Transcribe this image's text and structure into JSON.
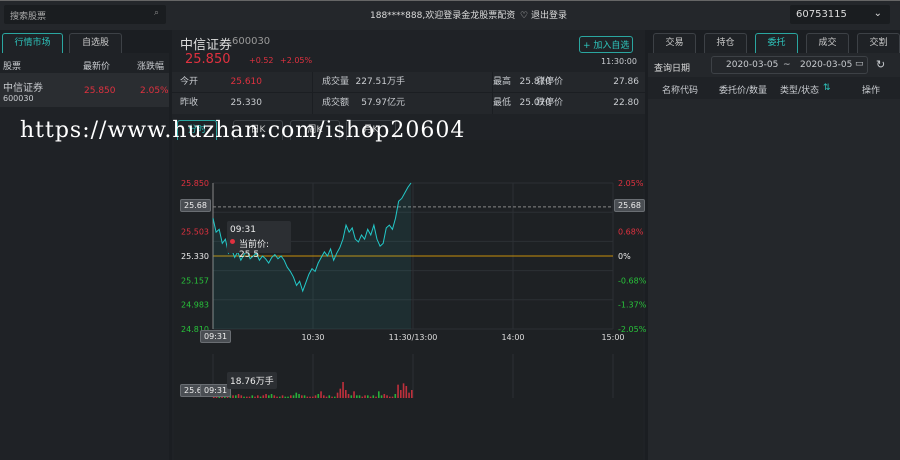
{
  "topbar": {
    "search_placeholder": "搜索股票",
    "welcome": "188****888,欢迎登录金龙股票配资",
    "logout": "退出登录",
    "account": "60753115"
  },
  "left": {
    "tabs": [
      "行情市场",
      "自选股"
    ],
    "headers": [
      "股票",
      "最新价",
      "涨跌幅"
    ],
    "items": [
      {
        "name": "中信证券",
        "code": "600030",
        "price": "25.850",
        "change": "2.05%"
      }
    ]
  },
  "stock": {
    "name": "中信证券",
    "code": "600030",
    "price": "25.850",
    "change": "+0.52",
    "change_pct": "+2.05%",
    "add_watch": "+ 加入自选",
    "time": "11:30:00",
    "stats": [
      [
        "今开",
        "25.610",
        "成交量",
        "227.51万手",
        "最高",
        "25.870",
        "涨停价",
        "27.86"
      ],
      [
        "昨收",
        "25.330",
        "成交额",
        "57.97亿元",
        "最低",
        "25.070",
        "跌停价",
        "22.80"
      ]
    ]
  },
  "chart_tabs": [
    "分时",
    "日K",
    "周K",
    "月K"
  ],
  "chart_data": {
    "type": "line",
    "x_ticks": [
      "09:31",
      "10:30",
      "11:30/13:00",
      "14:00",
      "15:00"
    ],
    "y_left": [
      "25.850",
      "25.503",
      "25.330",
      "25.157",
      "24.983",
      "24.810"
    ],
    "y_right": [
      "2.05%",
      "0.68%",
      "0%",
      "-0.68%",
      "-1.37%",
      "-2.05%"
    ],
    "ylim": [
      24.81,
      25.85
    ],
    "prev_close": 25.33,
    "crosshair_price": "25.68",
    "crosshair_time": "09:31",
    "tooltip": {
      "time": "09:31",
      "label": "当前价: 25.5"
    },
    "volume_tooltip": "18.76万手",
    "volume_axis_tag": "25.6",
    "prices": [
      25.6,
      25.5,
      25.52,
      25.42,
      25.45,
      25.35,
      25.38,
      25.32,
      25.36,
      25.3,
      25.34,
      25.37,
      25.31,
      25.33,
      25.35,
      25.3,
      25.33,
      25.31,
      25.28,
      25.32,
      25.34,
      25.31,
      25.33,
      25.3,
      25.25,
      25.22,
      25.18,
      25.12,
      25.15,
      25.08,
      25.14,
      25.2,
      25.24,
      25.22,
      25.28,
      25.32,
      25.36,
      25.33,
      25.38,
      25.3,
      25.35,
      25.39,
      25.45,
      25.55,
      25.5,
      25.53,
      25.45,
      25.43,
      25.48,
      25.45,
      25.52,
      25.48,
      25.55,
      25.45,
      25.4,
      25.42,
      25.53,
      25.55,
      25.52,
      25.6,
      25.72,
      25.74,
      25.78,
      25.82,
      25.85
    ],
    "volumes": [
      9,
      3,
      2,
      4,
      3,
      2,
      3,
      2,
      2,
      3,
      2,
      1,
      1,
      1,
      2,
      1,
      2,
      1,
      2,
      3,
      2,
      3,
      2,
      1,
      1,
      2,
      1,
      1,
      2,
      2,
      4,
      3,
      2,
      2,
      1,
      1,
      1,
      2,
      3,
      5,
      2,
      1,
      2,
      1,
      1,
      4,
      7,
      12,
      6,
      3,
      2,
      5,
      2,
      2,
      1,
      2,
      2,
      1,
      2,
      1,
      5,
      2,
      3,
      2,
      1,
      1,
      3,
      10,
      6,
      11,
      9,
      4,
      6
    ]
  },
  "right": {
    "tabs": [
      "交易",
      "持仓",
      "委托",
      "成交",
      "交割"
    ],
    "date_label": "查询日期",
    "date_from": "2020-03-05",
    "date_sep": "~",
    "date_to": "2020-03-05",
    "headers": [
      "名称代码",
      "委托价/数量",
      "类型/状态",
      "操作"
    ]
  },
  "watermark": "https://www.huzhan.com/ishop20604",
  "colors": {
    "accent": "#2ec4bc",
    "up": "#e0313f",
    "down": "#28c23a",
    "line": "#23c9c9",
    "base": "#c8900a"
  }
}
